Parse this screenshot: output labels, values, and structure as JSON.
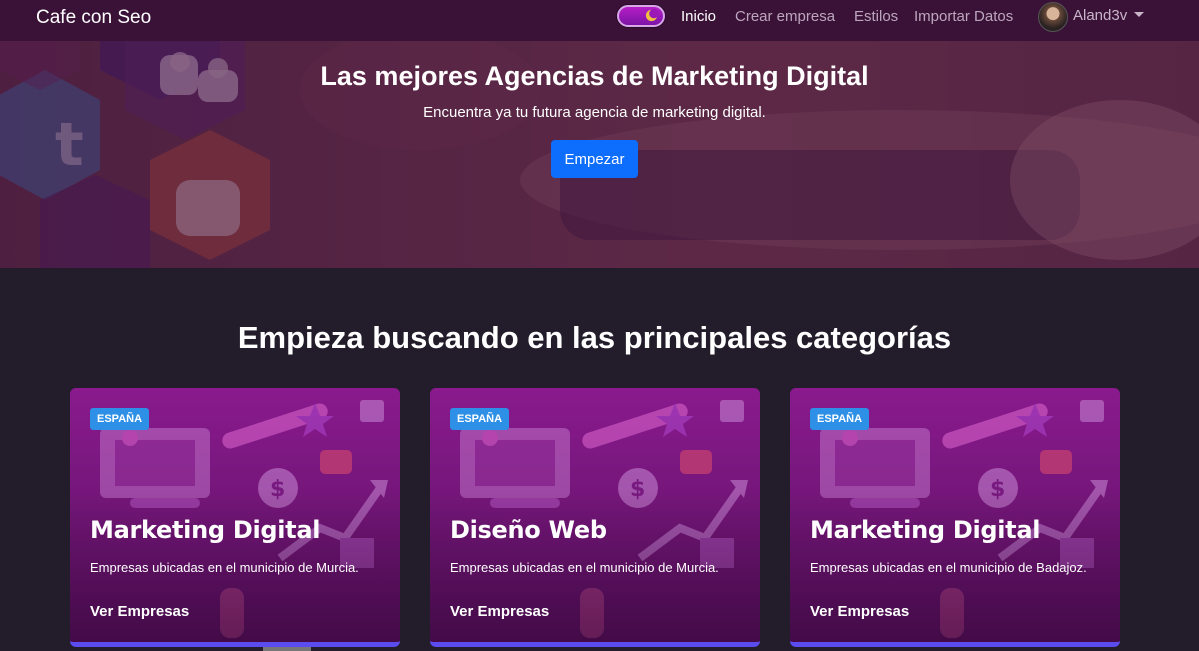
{
  "nav": {
    "brand": "Cafe con Seo",
    "links": [
      "Inicio",
      "Crear empresa",
      "Estilos",
      "Importar Datos"
    ],
    "user": "Aland3v",
    "theme_toggle": "dark"
  },
  "hero": {
    "title": "Las mejores Agencias de Marketing Digital",
    "subtitle": "Encuentra ya tu futura agencia de marketing digital.",
    "button": "Empezar"
  },
  "categories": {
    "title": "Empieza buscando en las principales categorías",
    "cards": [
      {
        "badge": "ESPAÑA",
        "title": "Marketing Digital",
        "desc": "Empresas ubicadas en el municipio de Murcia.",
        "link": "Ver Empresas"
      },
      {
        "badge": "ESPAÑA",
        "title": "Diseño Web",
        "desc": "Empresas ubicadas en el municipio de Murcia.",
        "link": "Ver Empresas"
      },
      {
        "badge": "ESPAÑA",
        "title": "Marketing Digital",
        "desc": "Empresas ubicadas en el municipio de Badajoz.",
        "link": "Ver Empresas"
      }
    ]
  },
  "colors": {
    "navbar": "#3a1238",
    "page_bg": "#231d2b",
    "primary_button": "#0d6efd",
    "card": "#7a177f",
    "badge": "#2e8fe6",
    "card_border": "#5b4cf0"
  }
}
